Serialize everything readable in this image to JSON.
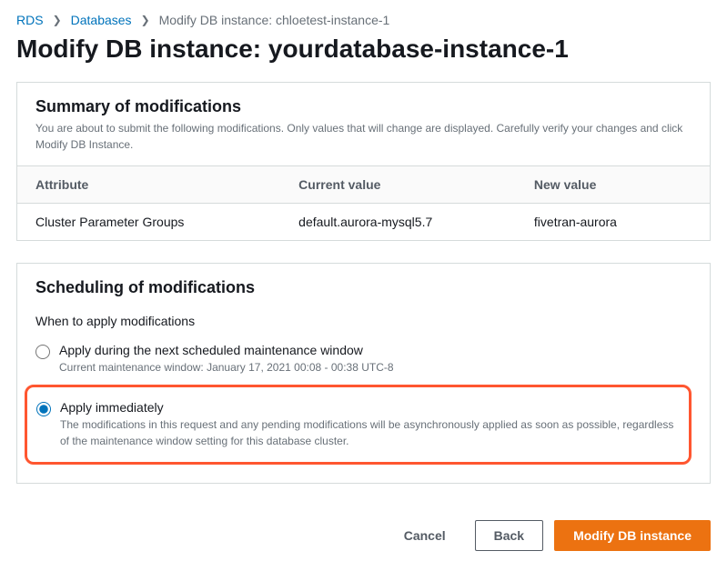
{
  "breadcrumb": {
    "rds": "RDS",
    "databases": "Databases",
    "current": "Modify DB instance: chloetest-instance-1"
  },
  "page_title": "Modify DB instance: yourdatabase-instance-1",
  "summary": {
    "title": "Summary of modifications",
    "desc": "You are about to submit the following modifications. Only values that will change are displayed. Carefully verify your changes and click Modify DB Instance.",
    "headers": {
      "attribute": "Attribute",
      "current": "Current value",
      "new": "New value"
    },
    "row": {
      "attribute": "Cluster Parameter Groups",
      "current": "default.aurora-mysql5.7",
      "new": "fivetran-aurora"
    }
  },
  "schedule": {
    "title": "Scheduling of modifications",
    "question": "When to apply modifications",
    "option_scheduled": {
      "label": "Apply during the next scheduled maintenance window",
      "sub": "Current maintenance window: January 17, 2021 00:08 - 00:38 UTC-8"
    },
    "option_immediate": {
      "label": "Apply immediately",
      "sub": "The modifications in this request and any pending modifications will be asynchronously applied as soon as possible, regardless of the maintenance window setting for this database cluster."
    }
  },
  "actions": {
    "cancel": "Cancel",
    "back": "Back",
    "modify": "Modify DB instance"
  }
}
